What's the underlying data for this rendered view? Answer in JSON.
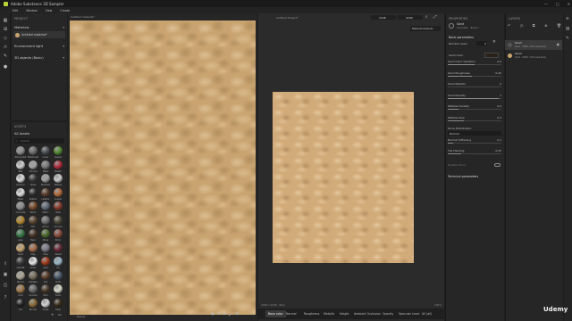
{
  "window": {
    "title": "Adobe Substance 3D Sampler",
    "buttons": [
      "—",
      "□",
      "✕"
    ]
  },
  "menu": [
    "Edit",
    "Window",
    "View",
    "Create"
  ],
  "left_panel": {
    "project_label": "PROJECT",
    "materials_label": "Materials",
    "material_item": "Untitled material*",
    "env_light_label": "Environment light",
    "objects_label": "3D objects (Basic)"
  },
  "assets": {
    "header": "ASSETS",
    "section": "All Assets",
    "search_placeholder": "Search",
    "items": [
      {
        "label": "Phong test",
        "color": "#8e8e8e"
      },
      {
        "label": "Metal test",
        "color": "#6b6b6b"
      },
      {
        "label": "Lunar",
        "color": "#4a4e52"
      },
      {
        "label": "Leaves",
        "color": "#4f8a2e"
      },
      {
        "label": "Ball",
        "color": "#cfcfcf"
      },
      {
        "label": "Chrome",
        "color": "#a6a6a6"
      },
      {
        "label": "Metal",
        "color": "#7a7a7a"
      },
      {
        "label": "Plastic",
        "color": "#b02a3a"
      },
      {
        "label": "Ceramic",
        "color": "#dcdcdc"
      },
      {
        "label": "Glass",
        "color": "#3a3a3a"
      },
      {
        "label": "Brushed",
        "color": "#9c9c9c"
      },
      {
        "label": "Marble",
        "color": "#c9c9c9"
      },
      {
        "label": "Paper",
        "color": "#e0e0e0"
      },
      {
        "label": "Rubber",
        "color": "#2e2e2e"
      },
      {
        "label": "Leather",
        "color": "#5a3b2a"
      },
      {
        "label": "Copper",
        "color": "#b46a3a"
      },
      {
        "label": "Concrete",
        "color": "#8d8d8d"
      },
      {
        "label": "Wood",
        "color": "#7a4b2a"
      },
      {
        "label": "Fabric",
        "color": "#5e6b7a"
      },
      {
        "label": "Rust",
        "color": "#8a3a2a"
      },
      {
        "label": "Gold",
        "color": "#b58a32"
      },
      {
        "label": "Dirt",
        "color": "#5a4630"
      },
      {
        "label": "Stone",
        "color": "#6e6e6e"
      },
      {
        "label": "Ground",
        "color": "#4e4a3a"
      },
      {
        "label": "Jade",
        "color": "#3a7a4a"
      },
      {
        "label": "Bark",
        "color": "#4a3526"
      },
      {
        "label": "Moss",
        "color": "#4a6a2a"
      },
      {
        "label": "Brick",
        "color": "#8a4a3a"
      },
      {
        "label": "Sand",
        "color": "#c9a471"
      },
      {
        "label": "Clay",
        "color": "#a86a4a"
      },
      {
        "label": "Tiles",
        "color": "#7a7a8a"
      },
      {
        "label": "Velvet",
        "color": "#6a2a3a"
      },
      {
        "label": "Asphalt",
        "color": "#3a3a3a"
      },
      {
        "label": "Snow",
        "color": "#e6e6e6"
      },
      {
        "label": "Lava",
        "color": "#a03a1a"
      },
      {
        "label": "Ice",
        "color": "#9ab8c8"
      },
      {
        "label": "Stucco",
        "color": "#b0a898"
      },
      {
        "label": "Pebbles",
        "color": "#7a6e5e"
      },
      {
        "label": "Soil",
        "color": "#5a3e2a"
      },
      {
        "label": "Cloth",
        "color": "#4a5a6a"
      },
      {
        "label": "Cork",
        "color": "#a0784a"
      },
      {
        "label": "Granite",
        "color": "#6a6a6a"
      },
      {
        "label": "Mud",
        "color": "#4a3a28"
      },
      {
        "label": "Foam",
        "color": "#d8d8c8"
      },
      {
        "label": "Tar",
        "color": "#202020"
      },
      {
        "label": "Bronze",
        "color": "#8a6a3a"
      },
      {
        "label": "Chalk",
        "color": "#d0d0d0"
      },
      {
        "label": "Peat",
        "color": "#3a2a1a"
      }
    ]
  },
  "viewport3d": {
    "label": "Untitled material*",
    "status": "Ready"
  },
  "viewport2d": {
    "label": "Untitled Project*",
    "material_output": "Material Outputs",
    "size_value": "2048",
    "res_value": "4096",
    "footer_left": "2048 x 2048 · 8bpc",
    "footer_right": "100%"
  },
  "bottom_tabs": [
    "Base color",
    "Normal",
    "Roughness",
    "Metallic",
    "Height",
    "Ambient Occlusion",
    "Opacity",
    "Specular Level",
    "All (all)"
  ],
  "properties": {
    "header": "PROPERTIES",
    "asset_name": "Sand",
    "asset_sub": "Generator · Built-in",
    "section_base": "Basic parameters",
    "random_seed_label": "Random seed",
    "random_seed_value": "0",
    "sand_color_label": "Sand Color",
    "section_textures": "Technical parameters",
    "params": [
      {
        "label": "Sand Color Variation",
        "value": "0.5",
        "fill": 0.5
      },
      {
        "label": "Sand Roughness",
        "value": "0.45",
        "fill": 0.45
      },
      {
        "label": "Sand Metallic",
        "value": "0",
        "fill": 0.0
      },
      {
        "label": "Sand Density",
        "value": "1",
        "fill": 0.95
      },
      {
        "label": "Pebbles Density",
        "value": "0.2",
        "fill": 0.2
      },
      {
        "label": "Pebbles Size",
        "value": "0.3",
        "fill": 0.3
      },
      {
        "label": "Dune Distribution",
        "value": "Normal",
        "fill": 0.0
      },
      {
        "label": "Normal Softening",
        "value": "0.1",
        "fill": 0.1
      },
      {
        "label": "Tile Hashing",
        "value": "0.25",
        "fill": 0.25
      }
    ],
    "emit_label": "Disable Dune"
  },
  "layers": {
    "header": "LAYERS",
    "items": [
      {
        "name": "Sand",
        "sub": "Sand · 2048 · [Full resolution]"
      },
      {
        "name": "Sand",
        "sub": "Sand · 2048 · [Full resolution]"
      }
    ]
  },
  "watermark": "Udemy",
  "colors": {
    "accent": "#b8d43a",
    "sand": "#c9a471",
    "panel": "#262626"
  }
}
